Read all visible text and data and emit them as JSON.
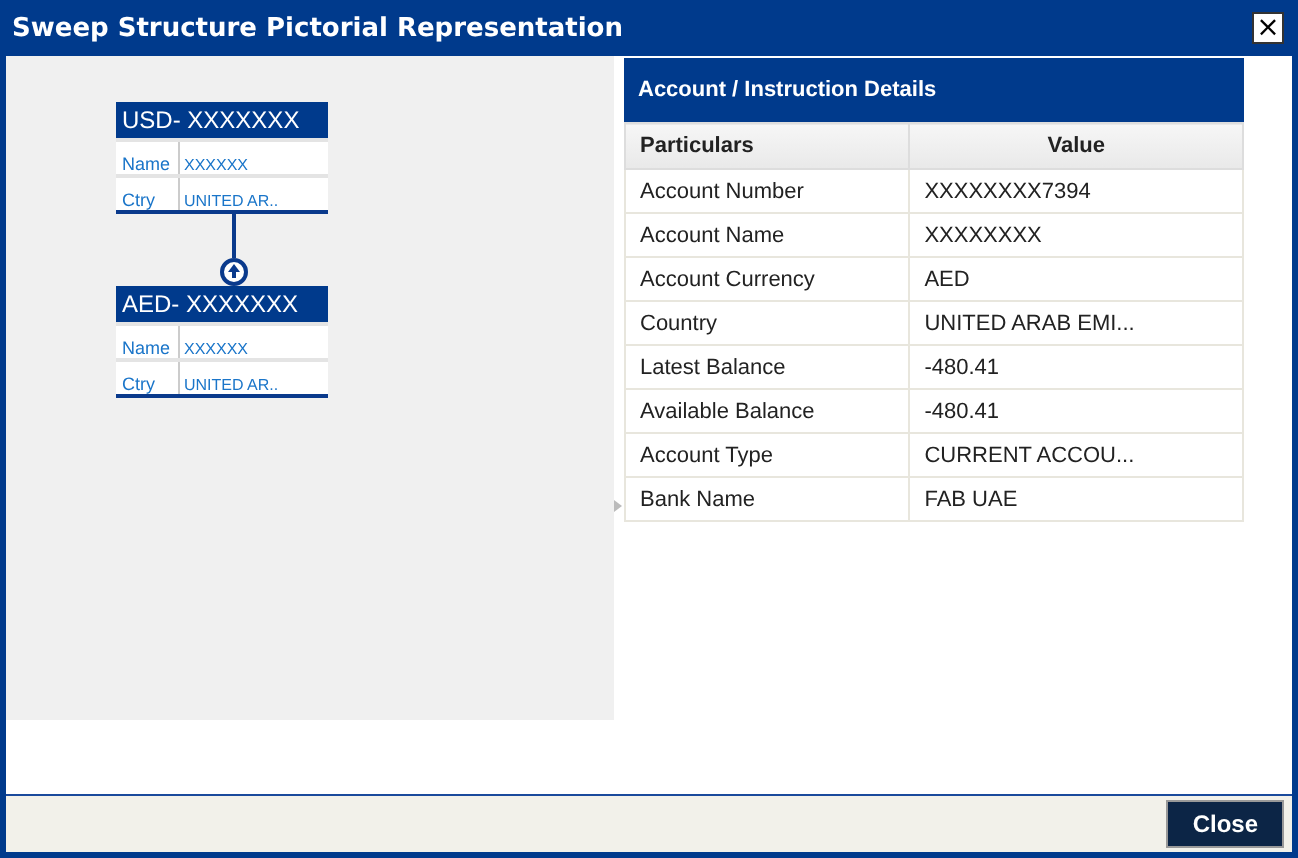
{
  "window": {
    "title": "Sweep Structure Pictorial Representation",
    "close_glyph": "×"
  },
  "structure": {
    "nodes": [
      {
        "header": "USD- XXXXXXX",
        "fields": [
          {
            "label": "Name",
            "value": "XXXXXX"
          },
          {
            "label": "Ctry",
            "value": "UNITED AR.."
          }
        ]
      },
      {
        "header": "AED- XXXXXXX",
        "fields": [
          {
            "label": "Name",
            "value": "XXXXXX"
          },
          {
            "label": "Ctry",
            "value": "UNITED AR.."
          }
        ]
      }
    ]
  },
  "details": {
    "title": "Account / Instruction Details",
    "columns": [
      "Particulars",
      "Value"
    ],
    "rows": [
      [
        "Account Number",
        "XXXXXXXX7394"
      ],
      [
        "Account Name",
        "XXXXXXXX"
      ],
      [
        "Account Currency",
        "AED"
      ],
      [
        "Country",
        "UNITED ARAB EMI..."
      ],
      [
        "Latest Balance",
        "-480.41"
      ],
      [
        "Available Balance",
        "-480.41"
      ],
      [
        "Account Type",
        "CURRENT ACCOU..."
      ],
      [
        "Bank Name",
        "FAB UAE"
      ]
    ]
  },
  "buttons": [
    "Close"
  ]
}
